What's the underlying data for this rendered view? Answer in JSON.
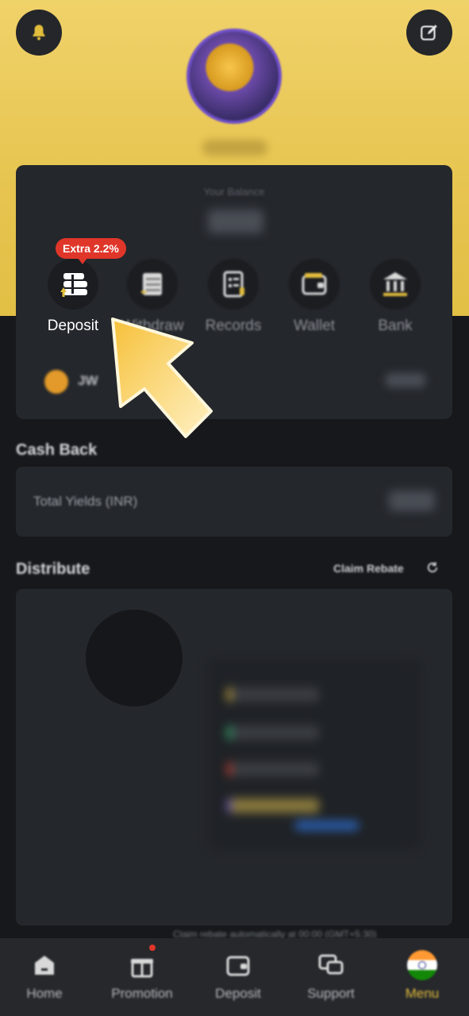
{
  "header": {
    "notification_icon": "bell-icon",
    "edit_icon": "edit-icon"
  },
  "balance_card": {
    "label": "Your Balance"
  },
  "actions": [
    {
      "label": "Deposit",
      "icon": "deposit-icon",
      "badge": "Extra 2.2%"
    },
    {
      "label": "Withdraw",
      "icon": "withdraw-icon"
    },
    {
      "label": "Records",
      "icon": "records-icon"
    },
    {
      "label": "Wallet",
      "icon": "wallet-icon"
    },
    {
      "label": "Bank",
      "icon": "bank-icon"
    }
  ],
  "jw_row": {
    "label": "JW"
  },
  "cash_back": {
    "title": "Cash Back",
    "total_yields_label": "Total Yields (INR)"
  },
  "distribute": {
    "title": "Distribute",
    "claim_label": "Claim Rebate",
    "legend_colors": [
      "#c9a53a",
      "#2fa36b",
      "#c0392b",
      "#6a56b8"
    ]
  },
  "footnote": "Claim rebate automatically at 00:00 (GMT+5:30)",
  "bottom_nav": [
    {
      "label": "Home",
      "icon": "home-icon"
    },
    {
      "label": "Promotion",
      "icon": "gift-icon"
    },
    {
      "label": "Deposit",
      "icon": "wallet-icon"
    },
    {
      "label": "Support",
      "icon": "chat-icon"
    },
    {
      "label": "Menu",
      "icon": "india-flag-icon",
      "active": true
    }
  ],
  "colors": {
    "accent": "#e2bd3c",
    "hero": "#e6c44f",
    "badge": "#e0362a",
    "background": "#16181b",
    "card": "#24272c"
  }
}
